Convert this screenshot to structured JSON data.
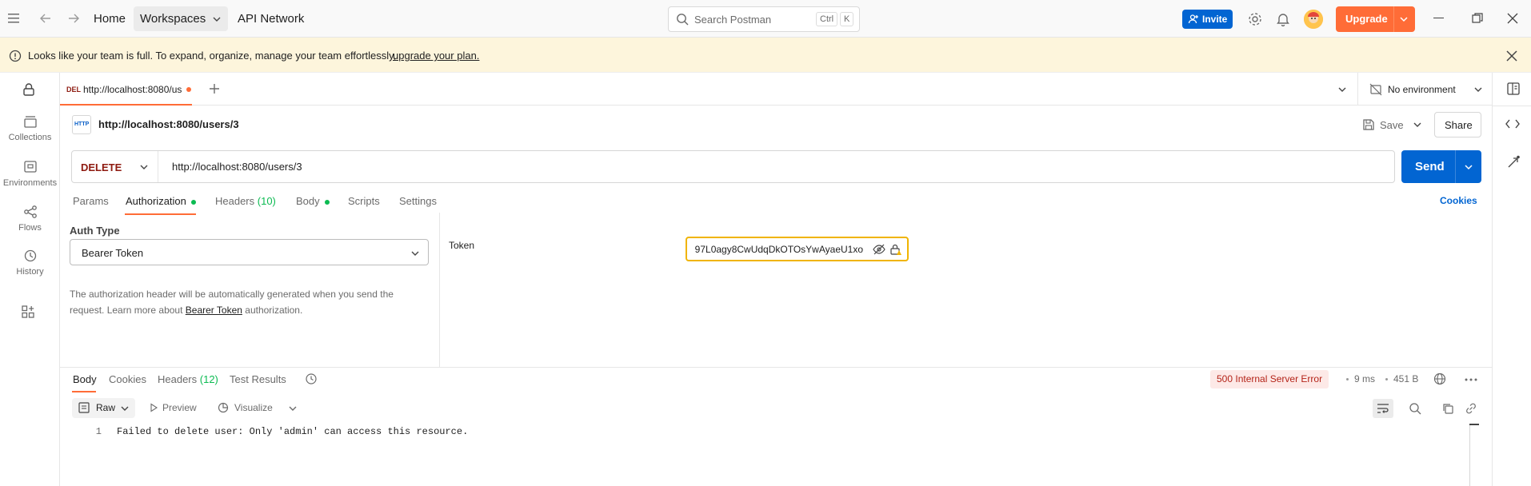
{
  "topbar": {
    "home": "Home",
    "workspaces": "Workspaces",
    "api_network": "API Network",
    "search_placeholder": "Search Postman",
    "shortcut_ctrl": "Ctrl",
    "shortcut_k": "K",
    "invite": "Invite",
    "upgrade": "Upgrade"
  },
  "banner": {
    "text": "Looks like your team is full. To expand, organize, manage your team effortlessly,",
    "link": "upgrade your plan."
  },
  "sidebar": {
    "items": [
      {
        "label": "Collections",
        "icon": "collections-icon"
      },
      {
        "label": "Environments",
        "icon": "environments-icon"
      },
      {
        "label": "Flows",
        "icon": "flows-icon"
      },
      {
        "label": "History",
        "icon": "history-icon"
      }
    ]
  },
  "tabs_bar": {
    "tab_method": "DEL",
    "tab_title": "http://localhost:8080/us",
    "environment": "No environment"
  },
  "request": {
    "title": "http://localhost:8080/users/3",
    "save": "Save",
    "share": "Share",
    "method": "DELETE",
    "url": "http://localhost:8080/users/3",
    "send": "Send",
    "http_badge": "HTTP"
  },
  "request_tabs": {
    "params": "Params",
    "authorization": "Authorization",
    "headers": "Headers",
    "headers_count": "(10)",
    "body": "Body",
    "scripts": "Scripts",
    "settings": "Settings",
    "cookies": "Cookies"
  },
  "auth": {
    "type_label": "Auth Type",
    "type_value": "Bearer Token",
    "desc_1": "The authorization header will be automatically generated when you send the",
    "desc_2": "request. Learn more about",
    "desc_link": "Bearer Token",
    "desc_3": "authorization.",
    "token_label": "Token",
    "token_value": "97L0agy8CwUdqDkOTOsYwAyaeU1xo"
  },
  "response": {
    "tabs": {
      "body": "Body",
      "cookies": "Cookies",
      "headers": "Headers",
      "headers_count": "(12)",
      "test_results": "Test Results"
    },
    "status": "500 Internal Server Error",
    "time": "9 ms",
    "size": "451 B",
    "format": "Raw",
    "preview": "Preview",
    "visualize": "Visualize",
    "line_number": "1",
    "line_text": "Failed to delete user: Only 'admin' can access this resource."
  },
  "colors": {
    "accent_orange": "#ff6c37",
    "send_blue": "#0265d2",
    "invite_blue": "#0265d2",
    "method_delete": "#8e1a10",
    "status_error_bg": "#fde9e7",
    "status_error_text": "#b42318",
    "banner_bg": "#fdf5dc",
    "token_border": "#f0b400"
  }
}
